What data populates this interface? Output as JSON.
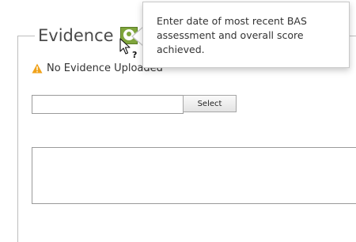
{
  "evidence": {
    "legend_title": "Evidence",
    "status_text": "No Evidence Uploaded",
    "file_input_value": "",
    "select_button_label": "Select",
    "notes_value": ""
  },
  "tooltip": {
    "text": "Enter date of most recent BAS assessment and overall score achieved."
  },
  "icons": {
    "help": "help-question-icon",
    "warning": "warning-triangle-icon",
    "cursor": "help-select-cursor-icon"
  },
  "colors": {
    "help_icon_green": "#7fa53c",
    "warning_orange": "#f0a21a"
  }
}
